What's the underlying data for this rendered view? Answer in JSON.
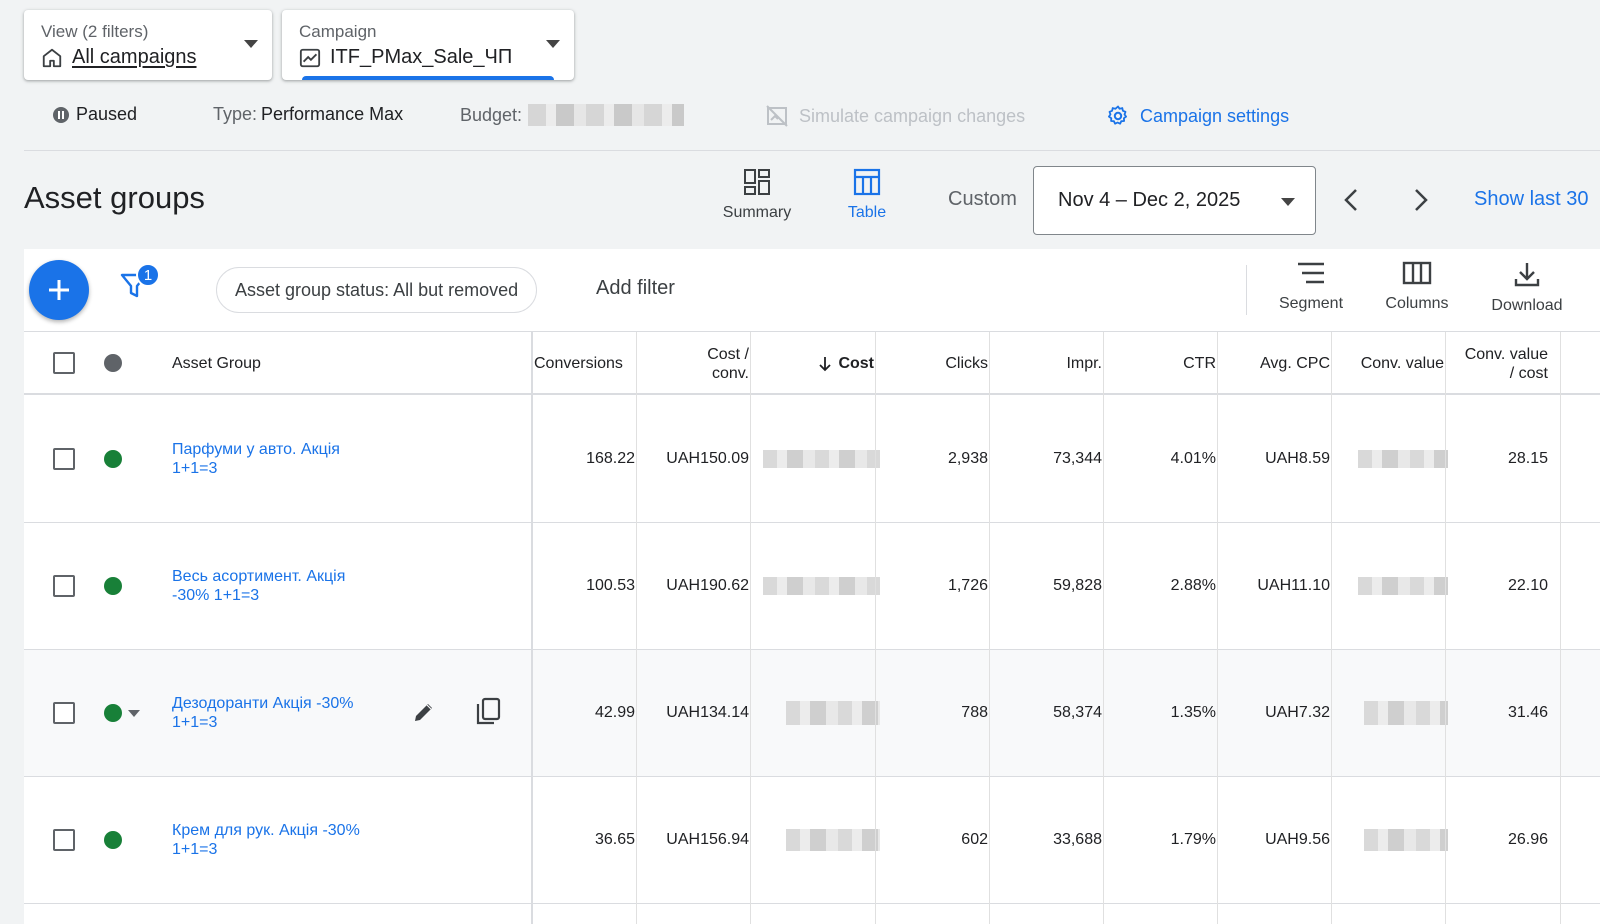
{
  "view_selector": {
    "label": "View (2 filters)",
    "value": "All campaigns"
  },
  "campaign_selector": {
    "label": "Campaign",
    "value": "ITF_PMax_Sale_ЧП"
  },
  "status_bar": {
    "status": "Paused",
    "type_label": "Type:",
    "type_value": "Performance Max",
    "budget_label": "Budget:",
    "simulate": "Simulate campaign changes",
    "settings": "Campaign settings"
  },
  "header": {
    "title": "Asset groups",
    "view_summary": "Summary",
    "view_table": "Table",
    "date_mode": "Custom",
    "date_range": "Nov 4 – Dec 2, 2025",
    "show_last": "Show last 30"
  },
  "toolbar": {
    "filter_count": "1",
    "filter_chip": "Asset group status: All but removed",
    "add_filter": "Add filter",
    "segment": "Segment",
    "columns": "Columns",
    "download": "Download"
  },
  "table": {
    "columns": {
      "asset_group": "Asset Group",
      "conversions": "Conversions",
      "cost_conv_1": "Cost /",
      "cost_conv_2": "conv.",
      "cost": "Cost",
      "clicks": "Clicks",
      "impr": "Impr.",
      "ctr": "CTR",
      "avg_cpc": "Avg. CPC",
      "conv_value": "Conv. value",
      "conv_value_cost_1": "Conv. value",
      "conv_value_cost_2": "/ cost"
    },
    "rows": [
      {
        "name": "Парфуми у авто. Акція 1+1=3",
        "conversions": "168.22",
        "cost_conv": "UAH150.09",
        "clicks": "2,938",
        "impr": "73,344",
        "ctr": "4.01%",
        "avg_cpc": "UAH8.59",
        "conv_value_cost": "28.15"
      },
      {
        "name": "Весь асортимент. Акція -30% 1+1=3",
        "conversions": "100.53",
        "cost_conv": "UAH190.62",
        "clicks": "1,726",
        "impr": "59,828",
        "ctr": "2.88%",
        "avg_cpc": "UAH11.10",
        "conv_value_cost": "22.10"
      },
      {
        "name": "Дезодоранти Акція -30% 1+1=3",
        "conversions": "42.99",
        "cost_conv": "UAH134.14",
        "clicks": "788",
        "impr": "58,374",
        "ctr": "1.35%",
        "avg_cpc": "UAH7.32",
        "conv_value_cost": "31.46"
      },
      {
        "name": "Крем для рук. Акція -30% 1+1=3",
        "conversions": "36.65",
        "cost_conv": "UAH156.94",
        "clicks": "602",
        "impr": "33,688",
        "ctr": "1.79%",
        "avg_cpc": "UAH9.56",
        "conv_value_cost": "26.96"
      }
    ]
  },
  "colors": {
    "accent": "#1a73e8",
    "enabled": "#188038",
    "status_header": "#5f6368"
  },
  "icons": [
    "home-icon",
    "trend-chart-icon",
    "pause-icon",
    "no-simulate-icon",
    "gear-icon",
    "summary-icon",
    "table-icon",
    "chevron-left-icon",
    "chevron-right-icon",
    "plus-icon",
    "filter-icon",
    "segment-icon",
    "columns-icon",
    "download-icon",
    "arrow-down-icon",
    "edit-icon",
    "copy-icon"
  ]
}
